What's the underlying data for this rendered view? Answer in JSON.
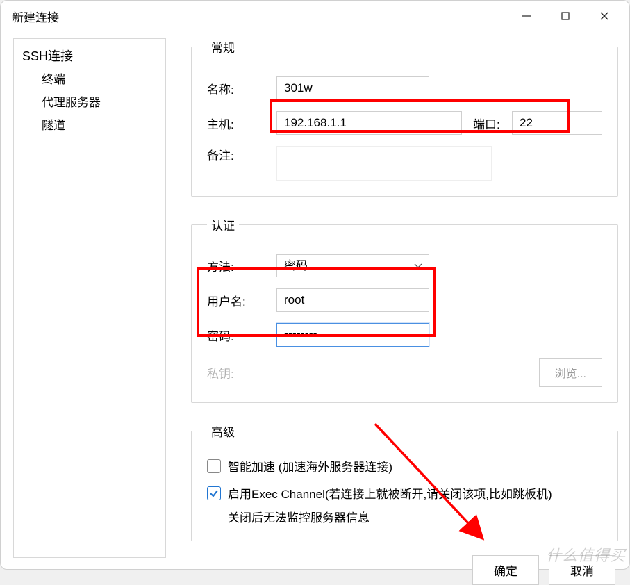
{
  "window": {
    "title": "新建连接"
  },
  "sidebar": {
    "root": "SSH连接",
    "items": [
      "终端",
      "代理服务器",
      "隧道"
    ]
  },
  "general": {
    "legend": "常规",
    "name_label": "名称:",
    "name_value": "301w",
    "host_label": "主机:",
    "host_value": "192.168.1.1",
    "port_label": "端口:",
    "port_value": "22",
    "note_label": "备注:",
    "note_value": ""
  },
  "auth": {
    "legend": "认证",
    "method_label": "方法:",
    "method_value": "密码",
    "user_label": "用户名:",
    "user_value": "root",
    "pass_label": "密码:",
    "pass_value": "••••••••",
    "key_label": "私钥:",
    "browse_label": "浏览..."
  },
  "advanced": {
    "legend": "高级",
    "smart_accel_checked": false,
    "smart_accel_label": "智能加速 (加速海外服务器连接)",
    "exec_channel_checked": true,
    "exec_channel_label": "启用Exec Channel(若连接上就被断开,请关闭该项,比如跳板机)",
    "exec_channel_sub": "关闭后无法监控服务器信息"
  },
  "footer": {
    "ok": "确定",
    "cancel": "取消"
  },
  "watermark": "什么值得买"
}
